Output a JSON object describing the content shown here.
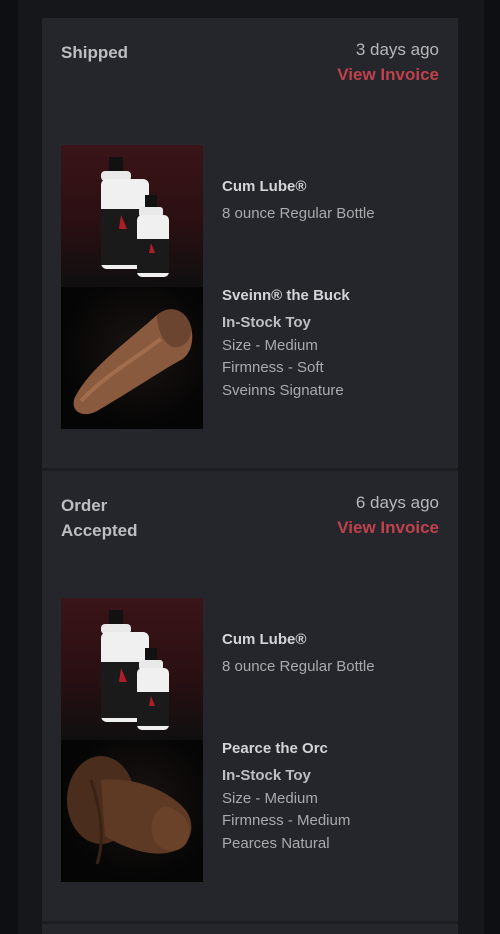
{
  "orders": [
    {
      "status": "Shipped",
      "date": "3 days ago",
      "invoice": "View Invoice",
      "items": [
        {
          "name": "Cum Lube®",
          "lines": [
            "8 ounce Regular Bottle"
          ],
          "image": "lube-bottles"
        },
        {
          "name": "Sveinn® the Buck",
          "lines": [
            "In-Stock Toy",
            "Size - Medium",
            "Firmness - Soft",
            "Sveinns Signature"
          ],
          "image": "toy-tan"
        }
      ]
    },
    {
      "status": "Order Accepted",
      "date": "6 days ago",
      "invoice": "View Invoice",
      "items": [
        {
          "name": "Cum Lube®",
          "lines": [
            "8 ounce Regular Bottle"
          ],
          "image": "lube-bottles"
        },
        {
          "name": "Pearce the Orc",
          "lines": [
            "In-Stock Toy",
            "Size - Medium",
            "Firmness - Medium",
            "Pearces Natural"
          ],
          "image": "toy-brown"
        }
      ]
    }
  ],
  "colors": {
    "accent": "#c0414b",
    "panel": "#25262b",
    "background": "#16171b"
  }
}
